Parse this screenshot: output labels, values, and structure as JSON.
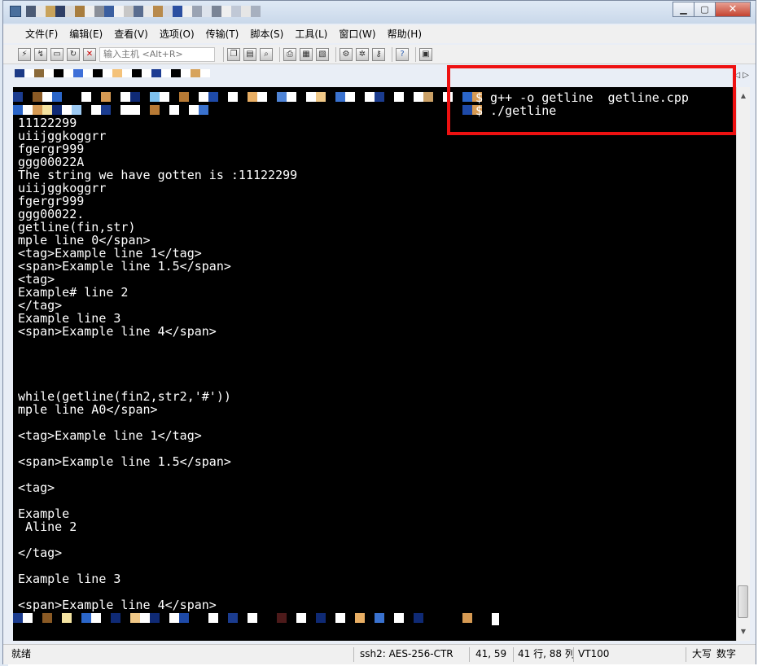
{
  "menu": [
    "文件(F)",
    "编辑(E)",
    "查看(V)",
    "选项(O)",
    "传输(T)",
    "脚本(S)",
    "工具(L)",
    "窗口(W)",
    "帮助(H)"
  ],
  "toolbar": {
    "host_placeholder": "输入主机 <Alt+R>"
  },
  "window_controls": {
    "minimize": "▁",
    "maximize": "▢",
    "close": "✕"
  },
  "terminal": {
    "commands": [
      "$ g++ -o getline  getline.cpp",
      "$ ./getline"
    ],
    "lines": [
      "11122299",
      "uiijggkoggrr",
      "fgergr999",
      "ggg00022A",
      "The string we have gotten is :11122299",
      "uiijggkoggrr",
      "fgergr999",
      "ggg00022.",
      "getline(fin,str)",
      "mple line 0</span>",
      "<tag>Example line 1</tag>",
      "<span>Example line 1.5</span>",
      "<tag>",
      "Example# line 2",
      "</tag>",
      "Example line 3",
      "<span>Example line 4</span>",
      "",
      "",
      "",
      "",
      "while(getline(fin2,str2,'#'))",
      "mple line A0</span>",
      "",
      "<tag>Example line 1</tag>",
      "",
      "<span>Example line 1.5</span>",
      "",
      "<tag>",
      "",
      "Example",
      " Aline 2",
      "",
      "</tag>",
      "",
      "Example line 3",
      "",
      "<span>Example line 4</span>"
    ]
  },
  "status": {
    "ready": "就绪",
    "encryption": "ssh2: AES-256-CTR",
    "position": "41,  59",
    "size": "41 行, 88 列",
    "terminal_type": "VT100",
    "caps": "大写",
    "num": "数字"
  },
  "colors": {
    "highlight": "#ee1111",
    "terminal_bg": "#000000",
    "terminal_fg": "#ffffff"
  }
}
